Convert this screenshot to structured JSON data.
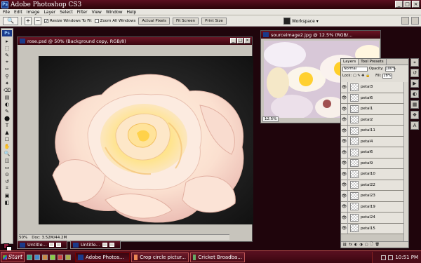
{
  "app": {
    "title": "Adobe Photoshop CS3",
    "logo_text": "Ps",
    "window_controls": [
      "_",
      "□",
      "×"
    ]
  },
  "menu": [
    "File",
    "Edit",
    "Image",
    "Layer",
    "Select",
    "Filter",
    "View",
    "Window",
    "Help"
  ],
  "options_bar": {
    "tool_icon": "zoom-icon",
    "resize_windows_label": "Resize Windows To Fit",
    "zoom_all_label": "Zoom All Windows",
    "actual_pixels_label": "Actual Pixels",
    "fit_screen_label": "Fit Screen",
    "print_size_label": "Print Size",
    "workspace_label": "Workspace ▾"
  },
  "tools": [
    "▸",
    "⬚",
    "✎",
    "⌖",
    "✂",
    "⚲",
    "✦",
    "⌫",
    "▤",
    "◐",
    "✎",
    "⬤",
    "T",
    "▲",
    "☐",
    "✋",
    "🔍",
    "◫",
    "▭",
    "⊙",
    "↺",
    "⌗",
    "▣",
    "◧"
  ],
  "doc": {
    "title": "rose.psd @ 50% (Background copy, RGB/8)",
    "status_zoom": "50%",
    "status_doc": "Doc: 3.52M/44.2M",
    "accent": "#8b1b3a"
  },
  "source": {
    "title": "sourceimage2.jpg @ 12.5% (RGB/...",
    "status_zoom": "12.5%"
  },
  "layers_panel": {
    "tabs": [
      "Layers",
      "Tool Presets"
    ],
    "blend_mode": "Normal",
    "opacity_label": "Opacity:",
    "opacity_value": "100%",
    "lock_label": "Lock:",
    "fill_label": "Fill:",
    "fill_value": "28%",
    "layers": [
      "petal3",
      "petal6",
      "petal1",
      "petal2",
      "petal11",
      "petal4",
      "petal6",
      "petal9",
      "petal10",
      "petal22",
      "petal23",
      "petal19",
      "petal24",
      "petal15"
    ],
    "footer_icons": [
      "⛓",
      "fx",
      "◐",
      "◑",
      "▢",
      "🗋",
      "🗑"
    ]
  },
  "minimized": [
    {
      "title": "Untitle..."
    },
    {
      "title": "Untitle..."
    }
  ],
  "taskbar": {
    "start_label": "Start",
    "tasks": [
      {
        "label": "Adobe Photos...",
        "active": true
      },
      {
        "label": "Crop circle pictur...",
        "active": false
      },
      {
        "label": "Cricket Broadba...",
        "active": false
      }
    ],
    "clock": "10:51 PM"
  }
}
